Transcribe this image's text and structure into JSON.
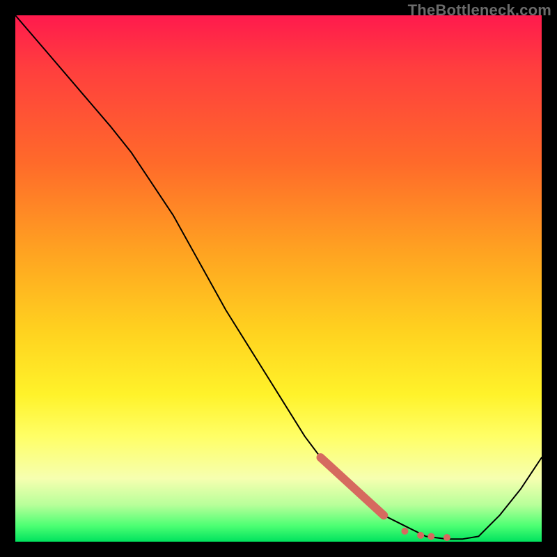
{
  "watermark": "TheBottleneck.com",
  "chart_data": {
    "type": "line",
    "title": "",
    "xlabel": "",
    "ylabel": "",
    "xlim": [
      0,
      100
    ],
    "ylim": [
      0,
      100
    ],
    "grid": false,
    "legend": false,
    "series": [
      {
        "name": "curve",
        "stroke": "#000000",
        "width": 2,
        "x": [
          0,
          6,
          12,
          18,
          22,
          26,
          30,
          35,
          40,
          45,
          50,
          55,
          58,
          62,
          66,
          70,
          74,
          78,
          82,
          85,
          88,
          92,
          96,
          100
        ],
        "y": [
          100,
          93,
          86,
          79,
          74,
          68,
          62,
          53,
          44,
          36,
          28,
          20,
          16,
          12,
          8,
          5,
          3,
          1,
          0.5,
          0.5,
          1,
          5,
          10,
          16
        ]
      }
    ],
    "markers": {
      "name": "highlight-dots",
      "color": "#d66a5f",
      "radius_thick_segment": 6,
      "radius_dot": 5,
      "thick_segment": {
        "x": [
          58,
          70
        ],
        "y": [
          16,
          5
        ]
      },
      "dots": [
        {
          "x": 74,
          "y": 2
        },
        {
          "x": 77,
          "y": 1.2
        },
        {
          "x": 79,
          "y": 1
        },
        {
          "x": 82,
          "y": 0.8
        }
      ]
    },
    "background_gradient_stops": [
      {
        "pct": 0,
        "color": "#ff1a4d"
      },
      {
        "pct": 28,
        "color": "#ff6a2a"
      },
      {
        "pct": 60,
        "color": "#ffd21f"
      },
      {
        "pct": 80,
        "color": "#ffff66"
      },
      {
        "pct": 97,
        "color": "#4cff73"
      },
      {
        "pct": 100,
        "color": "#00e25e"
      }
    ]
  }
}
